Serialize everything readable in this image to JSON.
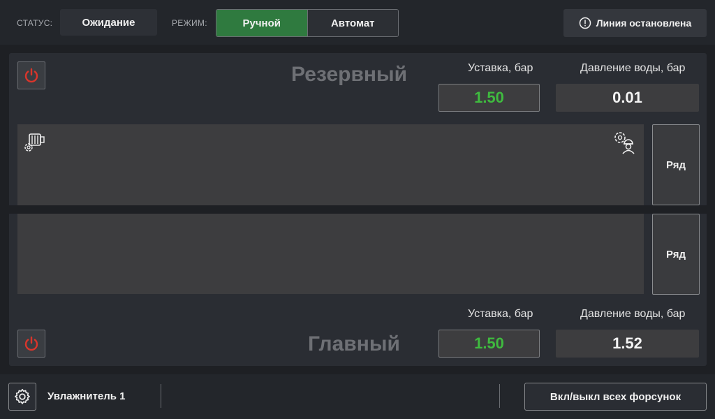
{
  "header": {
    "status_label": "СТАТУС:",
    "status_value": "Ожидание",
    "mode_label": "РЕЖИМ:",
    "modes": [
      {
        "label": "Ручной",
        "active": true
      },
      {
        "label": "Автомат",
        "active": false
      }
    ],
    "line_status": "Линия остановлена",
    "line_status_icon": "alert-circle-icon"
  },
  "reserve": {
    "title": "Резервный",
    "setpoint_label": "Уставка, бар",
    "setpoint_value": "1.50",
    "pressure_label": "Давление воды, бар",
    "pressure_value": "0.01",
    "power_icon": "power-icon",
    "row_button": "Ряд"
  },
  "main": {
    "title": "Главный",
    "setpoint_label": "Уставка, бар",
    "setpoint_value": "1.50",
    "pressure_label": "Давление воды, бар",
    "pressure_value": "1.52",
    "power_icon": "power-icon",
    "row_button": "Ряд"
  },
  "footer": {
    "device_name": "Увлажнитель 1",
    "toggle_all_label": "Вкл/выкл всех форсунок",
    "settings_icon": "gear-icon"
  },
  "colors": {
    "accent_green": "#2f7a3f",
    "setpoint_green": "#3fbb3f",
    "power_red": "#d9352b"
  }
}
